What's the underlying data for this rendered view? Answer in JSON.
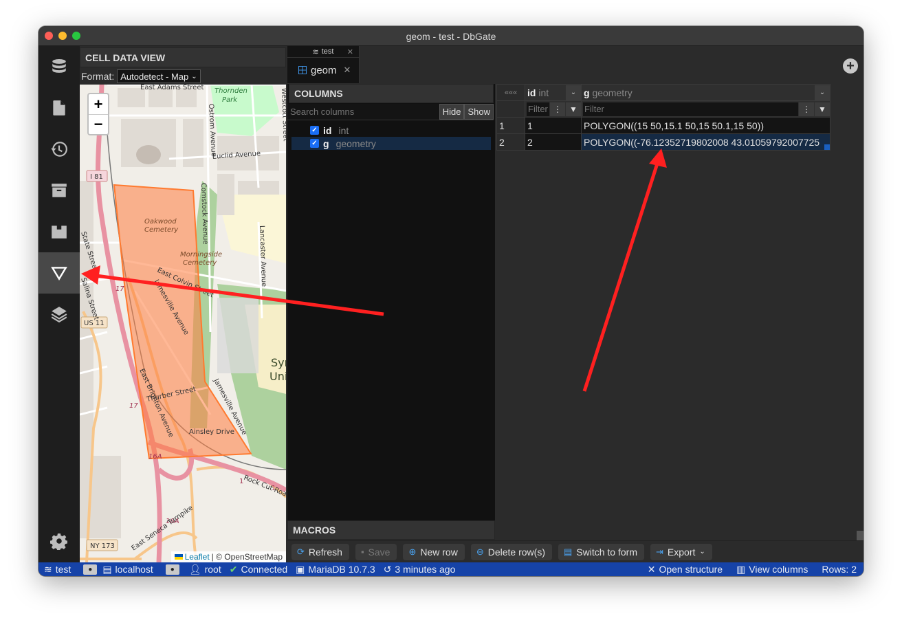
{
  "window": {
    "title": "geom - test - DbGate"
  },
  "widgetbar": {
    "items": [
      {
        "icon": "database-icon"
      },
      {
        "icon": "file-icon"
      },
      {
        "icon": "history-icon"
      },
      {
        "icon": "archive-icon"
      },
      {
        "icon": "plugin-icon"
      },
      {
        "icon": "cell-data-icon",
        "active": true
      },
      {
        "icon": "layers-icon"
      }
    ],
    "settings_icon": "gear-icon"
  },
  "cell_data_view": {
    "title": "CELL DATA VIEW",
    "format_label": "Format:",
    "format_value": "Autodetect - Map",
    "map": {
      "zoom_in": "+",
      "zoom_out": "−",
      "attribution_leaflet": "Leaflet",
      "attribution_osm": "| © OpenStreetMap",
      "labels": {
        "east_adams": "East Adams Street",
        "thornden": "Thornden",
        "park": "Park",
        "ostrom": "Ostrom Avenue",
        "euclid": "Euclid Avenue",
        "i81": "I 81",
        "oakwood": "Oakwood",
        "cemetery": "Cemetery",
        "morningside": "Morningside",
        "comstock": "Comstock Avenue",
        "lancaster": "Lancaster Avenue",
        "state_st": "State Street",
        "east_colvin": "East Colvin Street",
        "jamesville": "Jamesville Avenue",
        "us11": "US 11",
        "salina": "Salina Street",
        "thurber": "Thurber Street",
        "east_brighton": "East Brighton Avenue",
        "ainsley": "Ainsley Drive",
        "syr": "Syr",
        "univ": "Univ",
        "r17": "17",
        "r16a": "16A",
        "r1": "1",
        "rock_cut": "Rock Cut Road",
        "seneca": "East Seneca Turnpike",
        "ny173": "NY 173",
        "westcott": "Westcott Street"
      }
    }
  },
  "tabs": {
    "group_db": "test",
    "active_tab": "geom",
    "close": "✕"
  },
  "columns_panel": {
    "title": "COLUMNS",
    "search_placeholder": "Search columns",
    "hide_label": "Hide",
    "show_label": "Show",
    "columns": [
      {
        "name": "id",
        "type": "int",
        "checked": true,
        "selected": false
      },
      {
        "name": "g",
        "type": "geometry",
        "checked": true,
        "selected": true
      }
    ],
    "macros_title": "MACROS"
  },
  "grid": {
    "collapse_label": "«««",
    "columns": [
      {
        "name": "id",
        "type": "int",
        "filter_placeholder": "Filter"
      },
      {
        "name": "g",
        "type": "geometry",
        "filter_placeholder": "Filter"
      }
    ],
    "rows": [
      {
        "num": "1",
        "id": "1",
        "g": "POLYGON((15 50,15.1 50,15 50.1,15 50))"
      },
      {
        "num": "2",
        "id": "2",
        "g": "POLYGON((-76.12352719802008 43.01059792007725"
      }
    ]
  },
  "toolbar": {
    "refresh": "Refresh",
    "save": "Save",
    "new_row": "New row",
    "delete_rows": "Delete row(s)",
    "switch_to_form": "Switch to form",
    "export": "Export"
  },
  "statusbar": {
    "database": "test",
    "server": "localhost",
    "user": "root",
    "connection": "Connected",
    "engine": "MariaDB 10.7.3",
    "time": "3 minutes ago",
    "open_structure": "Open structure",
    "view_columns": "View columns",
    "rows": "Rows: 2"
  },
  "colors": {
    "status_bar": "#1643a8",
    "accent_blue": "#1a6ef5",
    "polygon_fill": "#ff7e3f",
    "annotation_arrow": "#ff2020",
    "number_value": "#7ccf4e"
  }
}
